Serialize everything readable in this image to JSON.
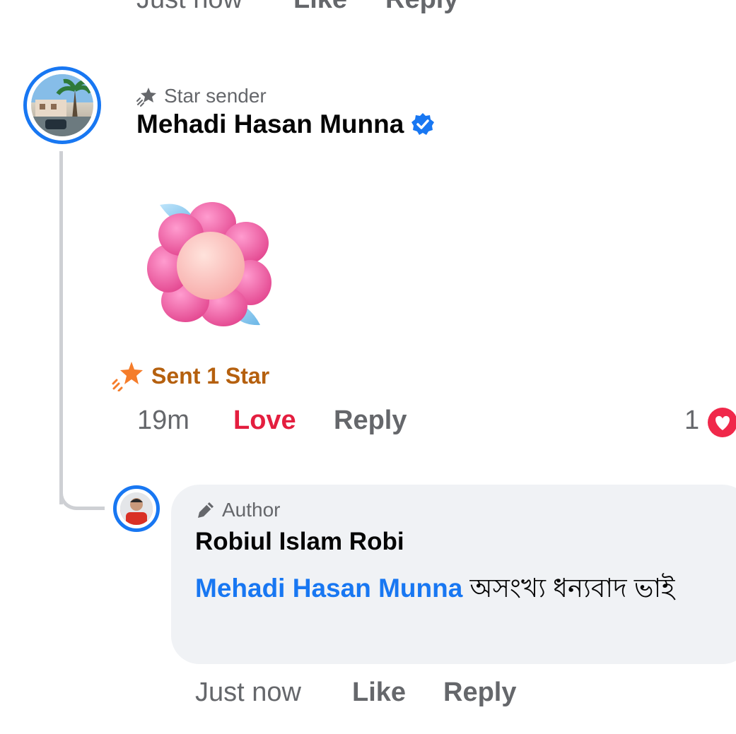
{
  "top_actions": {
    "time": "Just now",
    "like": "Like",
    "reply": "Reply"
  },
  "comment": {
    "badge": "Star sender",
    "badge_icon": "shooting-star-icon",
    "author": "Mehadi Hasan Munna",
    "verified_icon": "verified-badge-icon",
    "sticker": "pink-flower-sticker",
    "stars_label": "Sent 1 Star",
    "time": "19m",
    "love_label": "Love",
    "reply_label": "Reply",
    "reaction_count": "1",
    "reaction_icon": "love-reaction-icon"
  },
  "reply": {
    "badge": "Author",
    "badge_icon": "pencil-icon",
    "author": "Robiul Islam Robi",
    "mention": "Mehadi Hasan Munna",
    "text": " অসংখ্য ধন্যবাদ ভাই",
    "time": "Just now",
    "like_label": "Like",
    "reply_label": "Reply"
  },
  "colors": {
    "accent": "#1877f2",
    "love": "#e41e3f",
    "star": "#b5600e",
    "muted": "#65676b",
    "bubble": "#f0f2f5"
  }
}
